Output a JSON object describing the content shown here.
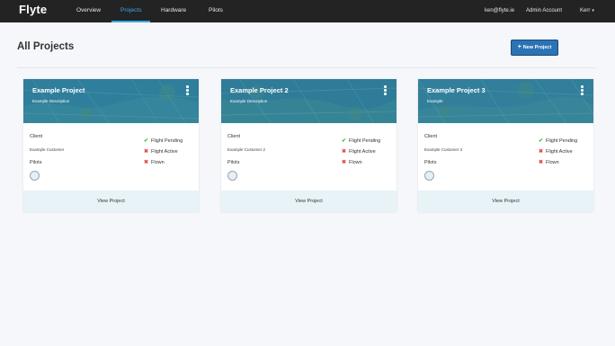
{
  "app": {
    "logo": "Flyte"
  },
  "nav": {
    "items": [
      {
        "label": "Overview"
      },
      {
        "label": "Projects"
      },
      {
        "label": "Hardware"
      },
      {
        "label": "Pilots"
      }
    ],
    "user_email": "ken@flyte.ie",
    "account": "Admin Account",
    "user_name": "Kerr"
  },
  "page": {
    "title": "All Projects",
    "new_button": "New Project",
    "new_button_icon": "+"
  },
  "cards": [
    {
      "title": "Example Project",
      "description": "Example Description",
      "client_label": "Client",
      "client": "Example Customer",
      "pilots_label": "Pilots",
      "statuses": [
        {
          "label": "Flight Pending",
          "state": "done"
        },
        {
          "label": "Flight Active",
          "state": "not-done"
        },
        {
          "label": "Flown",
          "state": "not-done"
        }
      ],
      "view_label": "View Project"
    },
    {
      "title": "Example Project 2",
      "description": "Example Description",
      "client_label": "Client",
      "client": "Example Customer 2",
      "pilots_label": "Pilots",
      "statuses": [
        {
          "label": "Flight Pending",
          "state": "done"
        },
        {
          "label": "Flight Active",
          "state": "not-done"
        },
        {
          "label": "Flown",
          "state": "not-done"
        }
      ],
      "view_label": "View Project"
    },
    {
      "title": "Example Project 3",
      "description": "Example",
      "client_label": "Client",
      "client": "Example Customer 3",
      "pilots_label": "Pilots",
      "statuses": [
        {
          "label": "Flight Pending",
          "state": "done"
        },
        {
          "label": "Flight Active",
          "state": "not-done"
        },
        {
          "label": "Flown",
          "state": "not-done"
        }
      ],
      "view_label": "View Project"
    }
  ],
  "icons": {
    "check": "✔",
    "cross": "✖"
  },
  "colors": {
    "accent": "#3da9e8",
    "button": "#2b73b4",
    "success": "#3bb24a",
    "error": "#e04b3c",
    "banner": "#2e7c99"
  }
}
